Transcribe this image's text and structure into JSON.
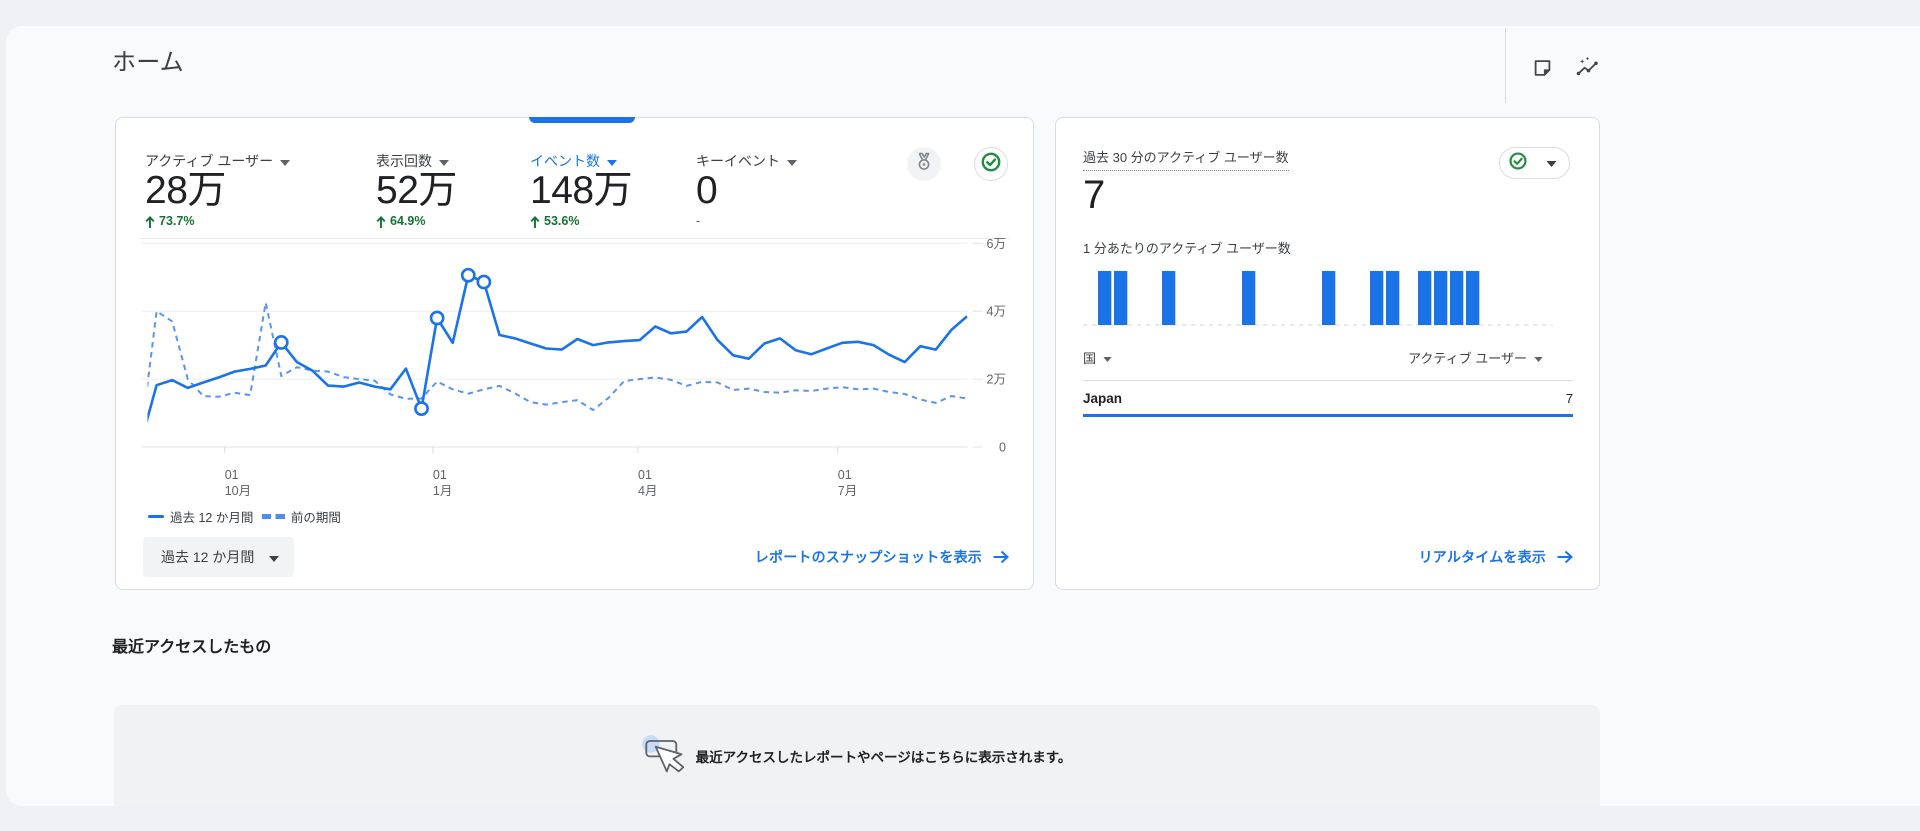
{
  "page": {
    "title": "ホーム"
  },
  "header": {
    "icons": [
      {
        "name": "note-icon"
      },
      {
        "name": "insights-icon"
      }
    ]
  },
  "overview_card": {
    "metrics": [
      {
        "label": "アクティブ ユーザー",
        "value": "28万",
        "change": "73.7%",
        "direction": "up",
        "selected": false
      },
      {
        "label": "表示回数",
        "value": "52万",
        "change": "64.9%",
        "direction": "up",
        "selected": false
      },
      {
        "label": "イベント数",
        "value": "148万",
        "change": "53.6%",
        "direction": "up",
        "selected": true
      },
      {
        "label": "キーイベント",
        "value": "0",
        "change": "-",
        "direction": "none",
        "selected": false
      }
    ],
    "legend": [
      {
        "label": "過去 12 か月間",
        "style": "solid"
      },
      {
        "label": "前の期間",
        "style": "dashed"
      }
    ],
    "range_button_label": "過去 12 か月間",
    "snapshot_link_label": "レポートのスナップショットを表示"
  },
  "realtime_card": {
    "title": "過去 30 分のアクティブ ユーザー数",
    "value": "7",
    "per_minute_label": "1 分あたりのアクティブ ユーザー数",
    "dimension_header": "国",
    "metric_header": "アクティブ ユーザー",
    "rows": [
      {
        "name": "Japan",
        "value": "7"
      }
    ],
    "realtime_link_label": "リアルタイムを表示"
  },
  "recent": {
    "heading": "最近アクセスしたもの",
    "empty_text": "最近アクセスしたレポートやページはこちらに表示されます。"
  },
  "colors": {
    "accent_blue": "#1a73e8",
    "dashed_blue": "#5b94f0",
    "positive_green": "#137333",
    "check_green": "#1e8e3e"
  },
  "chart_data": [
    {
      "id": "events-trend",
      "type": "line",
      "title": "イベント数",
      "unit": "万",
      "ylim": [
        0,
        6.2
      ],
      "y_ticks": [
        {
          "value": 0,
          "label": "0"
        },
        {
          "value": 2,
          "label": "2万"
        },
        {
          "value": 4,
          "label": "4万"
        },
        {
          "value": 6,
          "label": "6万"
        }
      ],
      "x_ticks": [
        {
          "week": 5.37,
          "line1": "01",
          "line2": "10月"
        },
        {
          "week": 18.73,
          "line1": "01",
          "line2": "1月"
        },
        {
          "week": 31.89,
          "line1": "01",
          "line2": "4月"
        },
        {
          "week": 44.71,
          "line1": "01",
          "line2": "7月"
        }
      ],
      "grid": true,
      "legend_position": "bottom",
      "series": [
        {
          "name": "過去 12 か月間",
          "style": "solid",
          "values": [
            0.15,
            1.82,
            1.97,
            1.74,
            1.9,
            2.05,
            2.22,
            2.3,
            2.4,
            3.08,
            2.5,
            2.25,
            1.81,
            1.78,
            1.9,
            1.78,
            1.7,
            2.31,
            1.13,
            3.8,
            3.07,
            5.06,
            4.86,
            3.3,
            3.2,
            3.05,
            2.9,
            2.87,
            3.18,
            3.0,
            3.08,
            3.12,
            3.15,
            3.55,
            3.35,
            3.4,
            3.83,
            3.15,
            2.7,
            2.6,
            3.05,
            3.2,
            2.85,
            2.73,
            2.9,
            3.07,
            3.1,
            3.0,
            2.72,
            2.5,
            2.97,
            2.87,
            3.45,
            3.85
          ],
          "marked_points": [
            9,
            18,
            19,
            21,
            22
          ]
        },
        {
          "name": "前の期間",
          "style": "dashed",
          "values": [
            0.3,
            4.0,
            3.7,
            2.0,
            1.5,
            1.48,
            1.6,
            1.53,
            4.25,
            2.09,
            2.35,
            2.25,
            2.22,
            2.06,
            2.0,
            1.95,
            1.55,
            1.42,
            1.43,
            1.93,
            1.7,
            1.57,
            1.7,
            1.8,
            1.58,
            1.32,
            1.25,
            1.32,
            1.38,
            1.09,
            1.45,
            1.94,
            2.0,
            2.05,
            1.98,
            1.8,
            1.92,
            1.9,
            1.68,
            1.72,
            1.62,
            1.6,
            1.67,
            1.65,
            1.72,
            1.76,
            1.7,
            1.72,
            1.62,
            1.56,
            1.4,
            1.3,
            1.5,
            1.43
          ],
          "marked_points": []
        }
      ]
    },
    {
      "id": "realtime-users-per-minute",
      "type": "bar",
      "title": "1 分あたりのアクティブ ユーザー数",
      "slots": 30,
      "active_minutes": [
        0,
        1,
        4,
        9,
        14,
        17,
        18,
        20,
        21,
        22,
        23
      ],
      "bar_value": 1,
      "ylim": [
        0,
        1
      ]
    }
  ]
}
